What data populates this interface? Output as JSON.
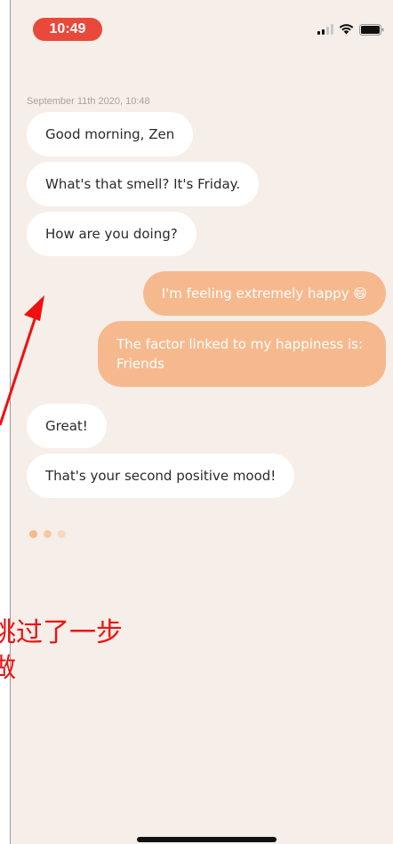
{
  "status_bar": {
    "time": "10:49",
    "signal_icon": "cellular-signal-icon",
    "wifi_icon": "wifi-icon",
    "battery_icon": "battery-icon",
    "time_pill_color": "#e8493a"
  },
  "chat": {
    "timestamp": "September 11th 2020, 10:48",
    "messages": [
      {
        "from": "bot",
        "text": "Good morning, Zen"
      },
      {
        "from": "bot",
        "text": "What's that smell? It's Friday."
      },
      {
        "from": "bot",
        "text": "How are you doing?"
      },
      {
        "from": "user",
        "text": "I'm feeling extremely happy 😄"
      },
      {
        "from": "user",
        "text": "The factor linked to my happiness is: Friends"
      },
      {
        "from": "bot",
        "text": "Great!"
      },
      {
        "from": "bot",
        "text": "That's your second positive mood!"
      }
    ],
    "typing_indicator_icon": "typing-dots-icon"
  },
  "annotation": {
    "line1": "跳过了一步",
    "line2": "做",
    "color": "#ee1111"
  },
  "colors": {
    "background": "#f6eee8",
    "bot_bubble": "#ffffff",
    "user_bubble": "#f6b98e",
    "typing_dot_dark": "#f4b98c",
    "typing_dot_light": "#f8d8bf"
  }
}
